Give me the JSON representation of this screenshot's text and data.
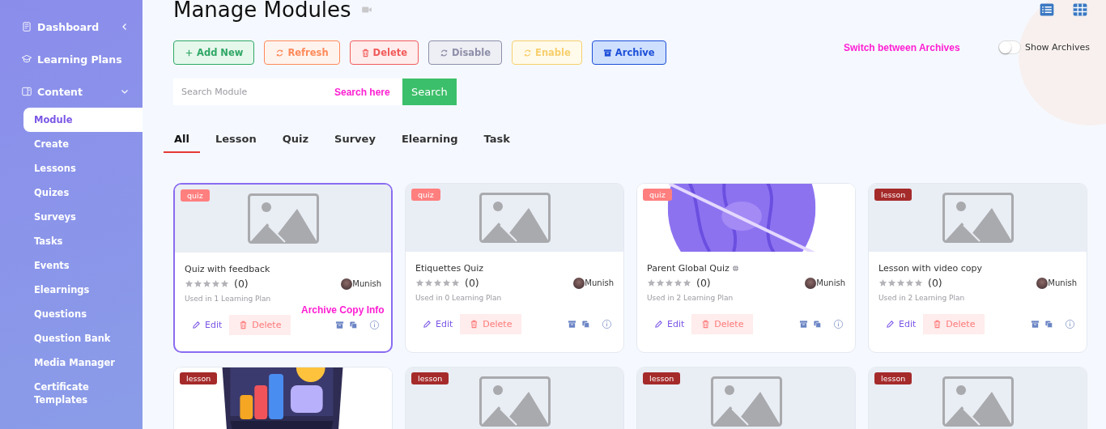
{
  "page": {
    "title": "Manage Modules"
  },
  "sidebar": {
    "items": [
      {
        "label": "Dashboard",
        "kind": "group",
        "expanded": false
      },
      {
        "label": "Learning Plans",
        "kind": "link"
      },
      {
        "label": "Content",
        "kind": "group",
        "expanded": true,
        "children": [
          {
            "label": "Module",
            "selected": true
          },
          {
            "label": "Create",
            "selected": false
          },
          {
            "label": "Lessons",
            "selected": false
          },
          {
            "label": "Quizes",
            "selected": false
          },
          {
            "label": "Surveys",
            "selected": false
          },
          {
            "label": "Tasks",
            "selected": false
          },
          {
            "label": "Events",
            "selected": false
          },
          {
            "label": "Elearnings",
            "selected": false
          },
          {
            "label": "Questions",
            "selected": false
          },
          {
            "label": "Question Bank",
            "selected": false
          },
          {
            "label": "Media Manager",
            "selected": false
          },
          {
            "label": "Certificate Templates",
            "selected": false
          }
        ]
      }
    ]
  },
  "toolbar": {
    "buttons": [
      {
        "label": "Add New",
        "kind": "add"
      },
      {
        "label": "Refresh",
        "kind": "refresh"
      },
      {
        "label": "Delete",
        "kind": "delete"
      },
      {
        "label": "Disable",
        "kind": "disable"
      },
      {
        "label": "Enable",
        "kind": "enable"
      },
      {
        "label": "Archive",
        "kind": "archive"
      }
    ]
  },
  "archives_switch": {
    "label": "Show Archives",
    "on": false
  },
  "search": {
    "placeholder": "Search Module",
    "button": "Search"
  },
  "tabs": [
    {
      "label": "All",
      "selected": true
    },
    {
      "label": "Lesson",
      "selected": false
    },
    {
      "label": "Quiz",
      "selected": false
    },
    {
      "label": "Survey",
      "selected": false
    },
    {
      "label": "Elearning",
      "selected": false
    },
    {
      "label": "Task",
      "selected": false
    }
  ],
  "cards": [
    {
      "badge": "quiz",
      "color": "#ff7f7f",
      "kind": "placeholder",
      "title": "Quiz with feedback",
      "global": false,
      "stars": 0,
      "rating": "(0)",
      "author": "Munish",
      "usage": "Used in 1 Learning Plan",
      "actions": [
        "Edit",
        "Delete"
      ],
      "selected": true
    },
    {
      "badge": "quiz",
      "color": "#ff7f7f",
      "kind": "placeholder",
      "title": "Etiquettes Quiz",
      "global": false,
      "stars": 0,
      "rating": "(0)",
      "author": "Munish",
      "usage": "Used in 0 Learning Plan",
      "actions": [
        "Edit",
        "Delete"
      ],
      "selected": false
    },
    {
      "badge": "quiz",
      "color": "#ff7f7f",
      "kind": "picture",
      "title": "Parent Global Quiz",
      "global": true,
      "stars": 0,
      "rating": "(0)",
      "author": "Munish",
      "usage": "Used in 2 Learning Plan",
      "actions": [
        "Edit",
        "Delete"
      ],
      "selected": false
    },
    {
      "badge": "lesson",
      "color": "#a52a2a",
      "kind": "placeholder",
      "title": "Lesson with video copy",
      "global": false,
      "stars": 0,
      "rating": "(0)",
      "author": "Munish",
      "usage": "Used in 2 Learning Plan",
      "actions": [
        "Edit",
        "Delete"
      ],
      "selected": false
    },
    {
      "badge": "lesson",
      "color": "#a52a2a",
      "kind": "picture",
      "selected": false
    },
    {
      "badge": "lesson",
      "color": "#a52a2a",
      "kind": "placeholder",
      "selected": false
    },
    {
      "badge": "lesson",
      "color": "#a52a2a",
      "kind": "placeholder",
      "selected": false
    },
    {
      "badge": "lesson",
      "color": "#a52a2a",
      "kind": "placeholder",
      "selected": false
    }
  ],
  "annotations": [
    {
      "text": "Switch between Archives",
      "kind": "switch"
    },
    {
      "text": "Search here",
      "kind": "search"
    },
    {
      "text": "Archive Copy Info",
      "kind": "card"
    }
  ]
}
